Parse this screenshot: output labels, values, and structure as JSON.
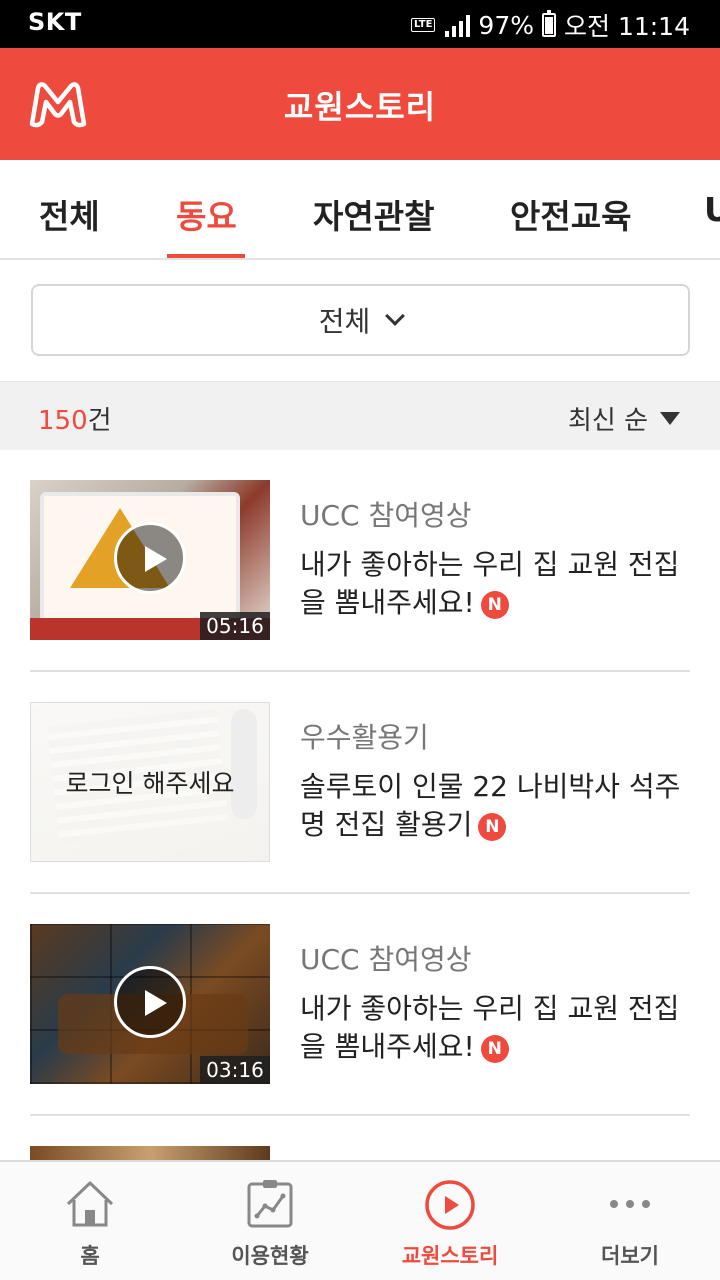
{
  "status_bar": {
    "carrier": "SKT",
    "network": "LTE",
    "battery": "97%",
    "battery_level": 0.97,
    "time": "오전 11:14"
  },
  "header": {
    "title": "교원스토리",
    "logo_icon": "m-logo-icon",
    "brand_color": "#ee4a3d"
  },
  "tabs": [
    {
      "label": "전체"
    },
    {
      "label": "동요",
      "active": true
    },
    {
      "label": "자연관찰"
    },
    {
      "label": "안전교육"
    },
    {
      "label": "U"
    }
  ],
  "filter": {
    "selected": "전체"
  },
  "results": {
    "count": "150",
    "unit": "건",
    "sort_label": "최신 순"
  },
  "items": [
    {
      "category": "UCC 참여영상",
      "title": "내가 좋아하는 우리 집 교원 전집을 뽐내주세요!",
      "duration": "05:16",
      "new_badge": "N"
    },
    {
      "category": "우수활용기",
      "title": "솔루토이 인물 22 나비박사 석주명 전집 활용기",
      "overlay": "로그인 해주세요",
      "new_badge": "N"
    },
    {
      "category": "UCC 참여영상",
      "title": "내가 좋아하는 우리 집 교원 전집을 뽐내주세요!",
      "duration": "03:16",
      "new_badge": "N"
    }
  ],
  "bottom_nav": [
    {
      "label": "홈",
      "icon": "home-icon"
    },
    {
      "label": "이용현황",
      "icon": "chart-icon"
    },
    {
      "label": "교원스토리",
      "icon": "play-circle-icon",
      "active": true
    },
    {
      "label": "더보기",
      "icon": "more-dots-icon"
    }
  ]
}
